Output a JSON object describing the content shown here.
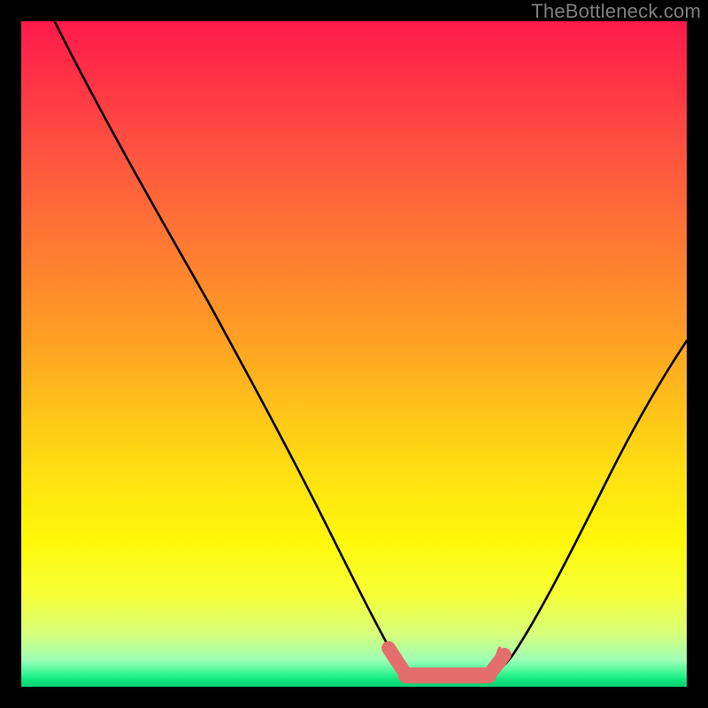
{
  "attribution": "TheBottleneck.com",
  "chart_data": {
    "type": "line",
    "title": "",
    "xlabel": "",
    "ylabel": "",
    "xlim": [
      0,
      100
    ],
    "ylim": [
      0,
      100
    ],
    "grid": false,
    "series": [
      {
        "name": "bottleneck-curve",
        "x": [
          5,
          10,
          15,
          20,
          25,
          30,
          35,
          40,
          45,
          50,
          55,
          58,
          60,
          62,
          65,
          68,
          72,
          75,
          80,
          85,
          90,
          95,
          100
        ],
        "values": [
          100,
          90,
          80,
          70,
          60,
          50,
          41,
          32,
          24,
          16,
          8,
          3,
          1,
          0,
          0,
          0,
          1,
          3,
          8,
          16,
          26,
          37,
          48
        ]
      }
    ],
    "annotations": [
      {
        "name": "optimal-region-marker",
        "x_start": 55,
        "x_end": 72,
        "y": 2
      }
    ],
    "gradient_stops": [
      {
        "pos": 0.0,
        "color": "#ff1a4a"
      },
      {
        "pos": 0.5,
        "color": "#ffb020"
      },
      {
        "pos": 0.8,
        "color": "#fff80a"
      },
      {
        "pos": 0.95,
        "color": "#9dffb8"
      },
      {
        "pos": 1.0,
        "color": "#08cf74"
      }
    ]
  }
}
